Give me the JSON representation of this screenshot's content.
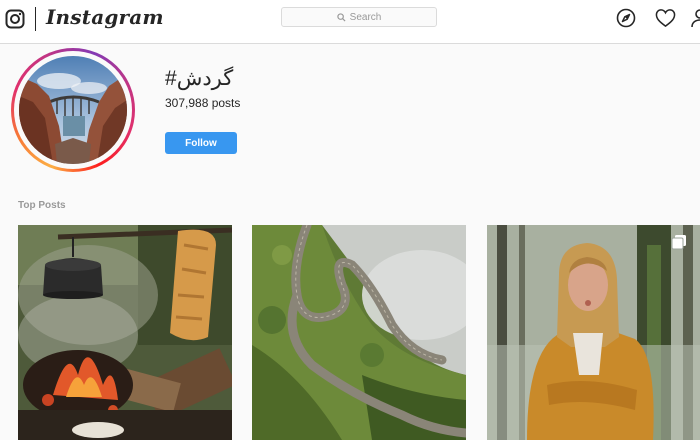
{
  "nav": {
    "brand": "Instagram",
    "search_placeholder": "Search"
  },
  "hashtag": {
    "title": "#گردش",
    "posts_count": "307,988 posts",
    "follow_label": "Follow"
  },
  "sections": {
    "top_posts_label": "Top Posts"
  },
  "posts": [
    {
      "subject": "campfire-with-kettle-and-bread"
    },
    {
      "subject": "winding-mountain-road"
    },
    {
      "subject": "woman-in-forest",
      "badge": "multiple-photos-icon"
    }
  ],
  "colors": {
    "follow_button": "#3897f0",
    "background": "#fafafa",
    "border": "#dbdbdb",
    "muted_text": "#999999"
  }
}
